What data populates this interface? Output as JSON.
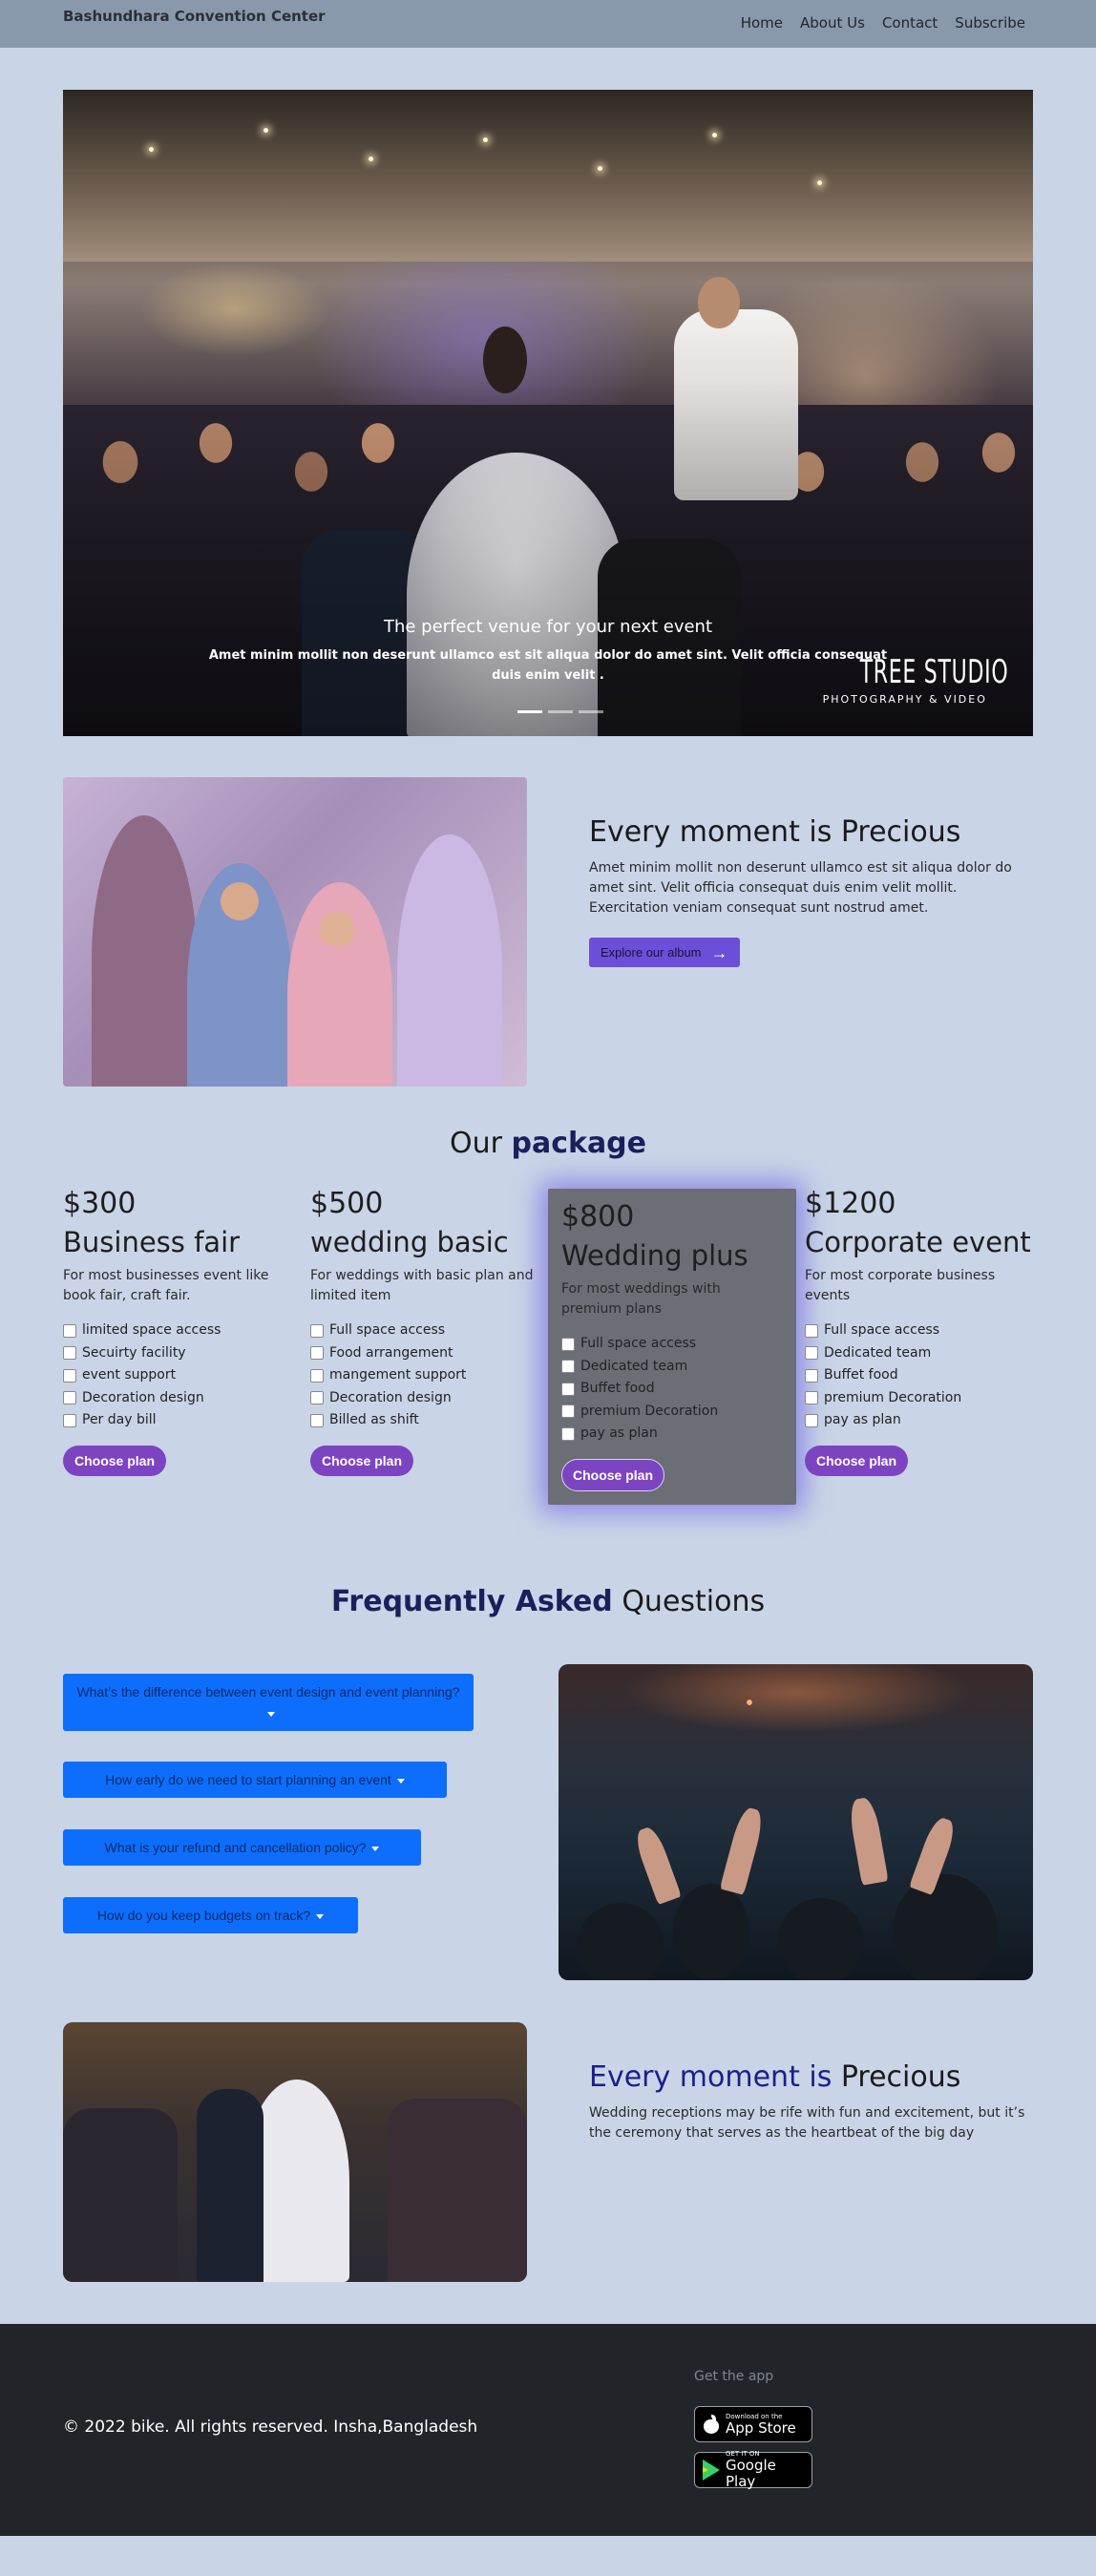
{
  "nav": {
    "brand": "Bashundhara Convention Center",
    "links": [
      "Home",
      "About Us",
      "Contact",
      "Subscribe"
    ]
  },
  "hero": {
    "title": "The perfect venue for your next event",
    "text": "Amet minim mollit non deserunt ullamco est sit aliqua dolor do amet sint. Velit officia consequat duis enim velit .",
    "watermark_line1": "TREE STUDIO",
    "watermark_line2": "PHOTOGRAPHY & VIDEO"
  },
  "moment1": {
    "heading": "Every moment is Precious",
    "text": "Amet minim mollit non deserunt ullamco est sit aliqua dolor do amet sint. Velit officia consequat duis enim velit mollit. Exercitation veniam consequat sunt nostrud amet.",
    "button": "Explore our album"
  },
  "packages": {
    "title_plain": "Our ",
    "title_bold": "package",
    "items": [
      {
        "price": "$300",
        "name": "Business fair",
        "desc": "For most businesses event like book fair, craft fair.",
        "features": [
          "limited space access",
          "Secuirty facility",
          "event support",
          "Decoration design",
          "Per day bill"
        ],
        "button": "Choose plan"
      },
      {
        "price": "$500",
        "name": "wedding basic",
        "desc": "For weddings with basic plan and limited item",
        "features": [
          "Full space access",
          "Food arrangement",
          "mangement support",
          "Decoration design",
          "Billed as shift"
        ],
        "button": "Choose plan"
      },
      {
        "price": "$800",
        "name": "Wedding plus",
        "desc": "For most weddings with premium plans",
        "features": [
          "Full space access",
          "Dedicated team",
          "Buffet food",
          "premium Decoration",
          "pay as plan"
        ],
        "button": "Choose plan"
      },
      {
        "price": "$1200",
        "name": "Corporate event",
        "desc": "For most corporate business events",
        "features": [
          "Full space access",
          "Dedicated team",
          "Buffet food",
          "premium Decoration",
          "pay as plan"
        ],
        "button": "Choose plan"
      }
    ]
  },
  "faq": {
    "title_bold": "Frequently Asked",
    "title_plain": " Questions",
    "questions": [
      "What’s the difference between event design and event planning?",
      "How early do we need to start planning an event",
      "What is your refund and cancellation policy?",
      "How do you keep budgets on track?"
    ]
  },
  "moment2": {
    "heading_colored": "Every moment is",
    "heading_plain": " Precious",
    "text": "Wedding receptions may be rife with fun and excitement, but it’s the ceremony that serves as the heartbeat of the big day"
  },
  "footer": {
    "copyright": "© 2022 bike. All rights reserved. Insha,Bangladesh",
    "get_app": "Get the app",
    "appstore_small": "Download on the",
    "appstore_big": "App Store",
    "googleplay_small": "GET IT ON",
    "googleplay_big": "Google Play"
  },
  "colors": {
    "page_bg": "#c9d5e6",
    "nav_bg": "#8999ab",
    "accent_purple": "#7d44c2",
    "explore_button": "#6b4fd8",
    "faq_button": "#0d6efd",
    "heading_navy": "#1b1f5c",
    "footer_bg": "#212529"
  }
}
